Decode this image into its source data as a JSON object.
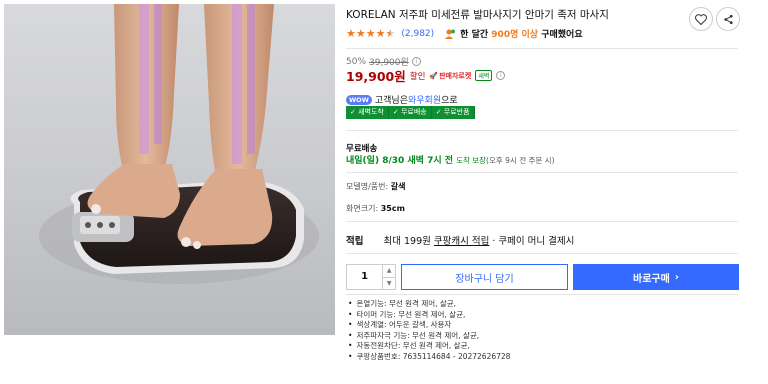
{
  "product": {
    "title": "KORELAN 저주파 미세전류 발마사지기 안마기 족저 마사지",
    "rating": 4.5,
    "review_count": "(2,982)",
    "buy_prefix": "한 달간",
    "buy_highlight": "900명 이상",
    "buy_suffix": "구매했어요"
  },
  "price": {
    "discount_rate": "50%",
    "original_price": "39,900원",
    "sale_price": "19,900원",
    "sale_label": "할인",
    "seller_badge": "판매자로켓",
    "dawn_tag": "새벽"
  },
  "wow": {
    "pill": "WOW",
    "prefix": "고객님은",
    "link": "와우회원",
    "suffix": "으로"
  },
  "benefits": [
    "✓ 새벽도착",
    "✓ 무료배송",
    "✓ 무료반품"
  ],
  "shipping": {
    "title": "무료배송",
    "date": "내일(일) 8/30 새벽 7시 전",
    "note": "도착 보장",
    "sub": "(오후 9시 전 주문 시)"
  },
  "options": [
    {
      "label": "모델명/품번:",
      "value": "갈색"
    },
    {
      "label": "화면크기:",
      "value": "35cm"
    }
  ],
  "cash": {
    "label": "적립",
    "prefix": "최대 199원",
    "link": "쿠팡캐시 적립",
    "suffix": "· 쿠페이 머니 결제시"
  },
  "purchase": {
    "quantity": "1",
    "cart_label": "장바구니 담기",
    "buy_label": "바로구매",
    "buy_arrow": "›"
  },
  "specs": [
    "온열기능: 무선 원격 제어, 살균,",
    "타이머 기능: 무선 원격 제어, 살균,",
    "색상계열: 어두운 갈색, 사용자",
    "저주파자극 기능: 무선 원격 제어, 살균,",
    "자동전원차단: 무선 원격 제어, 살균,",
    "쿠팡상품번호: 7635114684 - 20272626728"
  ],
  "colors": {
    "accent": "#346aff",
    "price_red": "#ae0000",
    "star_orange": "#f27a1a",
    "delivery_green": "#00891a"
  },
  "icons": {
    "heart": "heart-icon",
    "share": "share-icon",
    "info": "info-icon",
    "buy_count": "people-icon"
  }
}
